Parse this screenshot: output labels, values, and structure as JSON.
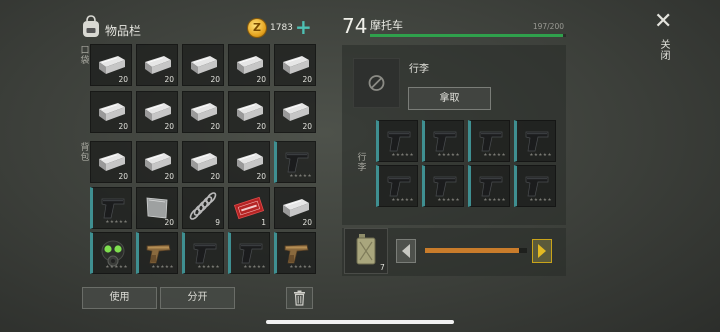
{
  "inventory": {
    "title": "物品栏",
    "coins": "1783",
    "coin_symbol": "Z",
    "add_label": "+",
    "section_pockets": "口袋",
    "section_backpack": "背包",
    "use_label": "使用",
    "split_label": "分开"
  },
  "slots": [
    {
      "item": "metal-bar",
      "qty": "20"
    },
    {
      "item": "metal-bar",
      "qty": "20"
    },
    {
      "item": "metal-bar",
      "qty": "20"
    },
    {
      "item": "metal-bar",
      "qty": "20"
    },
    {
      "item": "metal-bar",
      "qty": "20"
    },
    {
      "item": "metal-bar",
      "qty": "20"
    },
    {
      "item": "metal-bar",
      "qty": "20"
    },
    {
      "item": "metal-bar",
      "qty": "20"
    },
    {
      "item": "metal-bar",
      "qty": "20"
    },
    {
      "item": "metal-bar",
      "qty": "20"
    },
    {
      "item": "metal-bar",
      "qty": "20"
    },
    {
      "item": "metal-bar",
      "qty": "20"
    },
    {
      "item": "metal-bar",
      "qty": "20"
    },
    {
      "item": "metal-bar",
      "qty": "20"
    },
    {
      "item": "pistol",
      "qty": "",
      "teal": true
    },
    {
      "item": "pistol",
      "qty": "",
      "teal": true
    },
    {
      "item": "metal-plate",
      "qty": "20"
    },
    {
      "item": "spring",
      "qty": "9"
    },
    {
      "item": "red-ticket",
      "qty": "1"
    },
    {
      "item": "metal-bar",
      "qty": "20"
    },
    {
      "item": "gas-mask",
      "qty": "",
      "teal": true
    },
    {
      "item": "flare-gun",
      "qty": "",
      "teal": true
    },
    {
      "item": "pistol",
      "qty": "",
      "teal": true
    },
    {
      "item": "pistol",
      "qty": "",
      "teal": true
    },
    {
      "item": "flare-gun",
      "qty": "",
      "teal": true
    }
  ],
  "vehicle": {
    "number": "74",
    "name": "摩托车",
    "capacity": "197/200",
    "fill_fraction": 0.985,
    "luggage_label": "行李",
    "take_label": "拿取",
    "section_label": "行李",
    "stars": "★★★★★",
    "fuel_qty": "7",
    "fuel_fraction": 0.92
  },
  "close_label": "关闭",
  "colors": {
    "accent_teal": "#3f8f91",
    "capacity_green": "#2fa04c",
    "slider_orange": "#c97c2b",
    "arrow_yellow": "#c9a41a"
  }
}
